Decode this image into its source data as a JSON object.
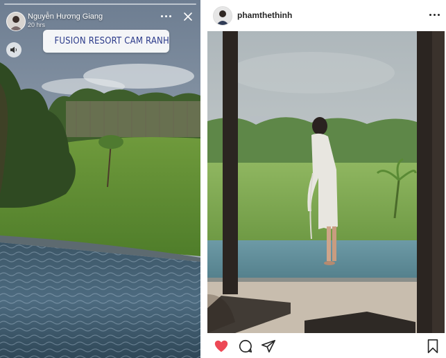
{
  "story": {
    "username": "Nguyễn Hương Giang",
    "time": "20 hrs",
    "location": "FUSION RESORT CAM RANH",
    "icons": [
      "more-icon",
      "close-icon",
      "sound-icon",
      "location-pin-icon"
    ]
  },
  "post": {
    "username": "phamthethinh",
    "actions": {
      "like": "heart-filled-icon",
      "comment": "comment-icon",
      "share": "send-icon",
      "save": "bookmark-icon"
    },
    "liked": true
  },
  "colors": {
    "like_red": "#ed4956",
    "location_text": "#2b3a8a"
  }
}
